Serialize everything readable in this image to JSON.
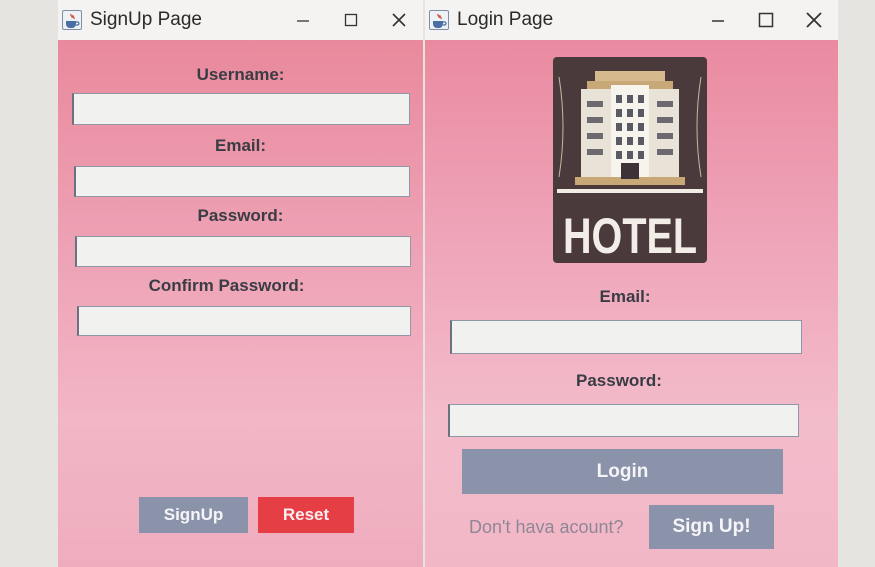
{
  "signup_window": {
    "title": "SignUp Page",
    "username_label": "Username:",
    "email_label": "Email:",
    "password_label": "Password:",
    "confirm_password_label": "Confirm Password:",
    "username_value": "",
    "email_value": "",
    "password_value": "",
    "confirm_password_value": "",
    "signup_button": "SignUp",
    "reset_button": "Reset"
  },
  "login_window": {
    "title": "Login Page",
    "logo_text": "HOTEL",
    "email_label": "Email:",
    "password_label": "Password:",
    "email_value": "",
    "password_value": "",
    "login_button": "Login",
    "no_account_text": "Don't hava acount?",
    "signup_button": "Sign Up!"
  },
  "colors": {
    "form_background": "#ee9fb3",
    "button_gray": "#8b93ab",
    "button_red": "#e53e45",
    "label_text": "#3a3c44",
    "hint_text": "#8f8795"
  },
  "icons": {
    "app_icon": "java-coffee-cup-icon",
    "minimize": "minimize-icon",
    "maximize": "maximize-icon",
    "close": "close-icon"
  }
}
